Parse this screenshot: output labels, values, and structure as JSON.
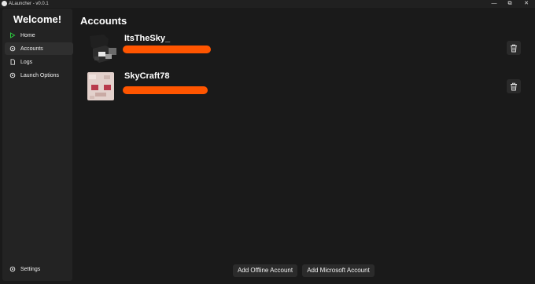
{
  "window": {
    "title": "ALauncher - v0.0.1",
    "controls": {
      "minimize": "—",
      "maximize": "⧉",
      "close": "✕"
    }
  },
  "sidebar": {
    "welcome": "Welcome!",
    "items": [
      {
        "label": "Home",
        "icon": "play-icon",
        "active": false
      },
      {
        "label": "Accounts",
        "icon": "gear-icon",
        "active": true
      },
      {
        "label": "Logs",
        "icon": "document-icon",
        "active": false
      },
      {
        "label": "Launch Options",
        "icon": "gear-icon",
        "active": false
      }
    ],
    "settings_label": "Settings"
  },
  "main": {
    "title": "Accounts",
    "accounts": [
      {
        "name": "ItsTheSky_",
        "email_redacted": true
      },
      {
        "name": "SkyCraft78",
        "email_redacted": true
      }
    ],
    "add_offline_label": "Add Offline Account",
    "add_microsoft_label": "Add Microsoft Account"
  },
  "colors": {
    "background": "#1a1a1a",
    "sidebar": "#232323",
    "active_item": "#2f2f2f",
    "home_icon": "#2ecc40",
    "redaction": "#ff5500"
  }
}
